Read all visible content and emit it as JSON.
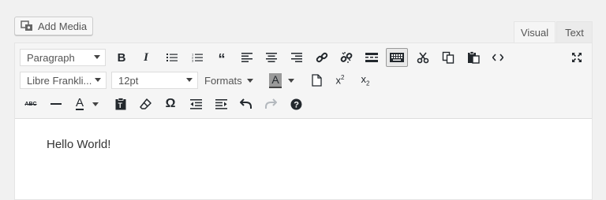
{
  "add_media": {
    "label": "Add Media"
  },
  "tabs": [
    {
      "label": "Visual"
    },
    {
      "label": "Text"
    }
  ],
  "toolbar": {
    "format_select": "Paragraph",
    "font_family_select": "Libre Frankli...",
    "font_size_select": "12pt",
    "formats_menu": "Formats",
    "text_color_glyph": "A",
    "bg_color_glyph": "A",
    "special_char_glyph": "Ω",
    "strikethrough_glyph": "ABC"
  },
  "content": {
    "text": "Hello World!"
  }
}
